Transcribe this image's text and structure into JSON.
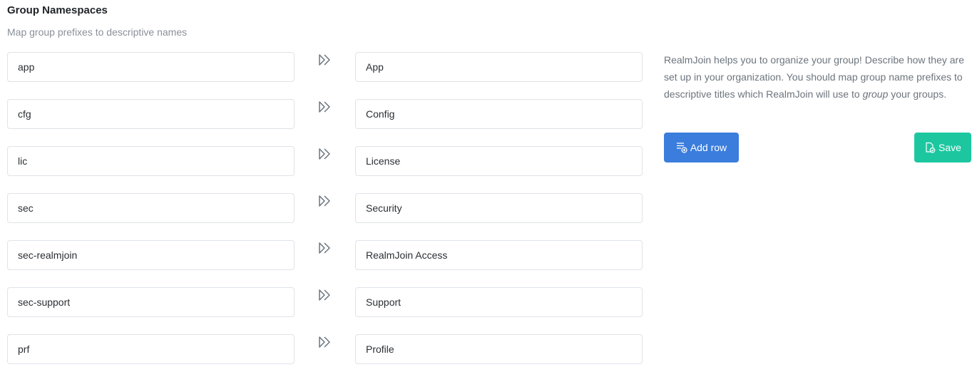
{
  "header": {
    "title": "Group Namespaces",
    "subtitle": "Map group prefixes to descriptive names"
  },
  "rows": [
    {
      "prefix": "app",
      "name": "App"
    },
    {
      "prefix": "cfg",
      "name": "Config"
    },
    {
      "prefix": "lic",
      "name": "License"
    },
    {
      "prefix": "sec",
      "name": "Security"
    },
    {
      "prefix": "sec-realmjoin",
      "name": "RealmJoin Access"
    },
    {
      "prefix": "sec-support",
      "name": "Support"
    },
    {
      "prefix": "prf",
      "name": "Profile"
    }
  ],
  "info": {
    "text_before": "RealmJoin helps you to organize your group! Describe how they are set up in your organization. You should map group name prefixes to descriptive titles which RealmJoin will use to ",
    "text_emphasis": "group",
    "text_after": " your groups."
  },
  "actions": {
    "add_row_label": "Add row",
    "save_label": "Save"
  },
  "icons": {
    "arrow": "double-chevron-right-icon",
    "add_row": "list-add-icon",
    "save": "file-check-icon"
  },
  "colors": {
    "primary": "#3b7ddd",
    "success": "#1cc7a0",
    "muted_text": "#6c757d",
    "border": "#dfe3e8"
  }
}
